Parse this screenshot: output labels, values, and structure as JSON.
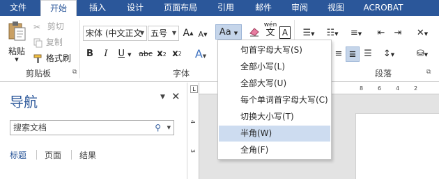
{
  "tabs": [
    {
      "label": "文件"
    },
    {
      "label": "开始"
    },
    {
      "label": "插入"
    },
    {
      "label": "设计"
    },
    {
      "label": "页面布局"
    },
    {
      "label": "引用"
    },
    {
      "label": "邮件"
    },
    {
      "label": "审阅"
    },
    {
      "label": "视图"
    },
    {
      "label": "ACROBAT"
    }
  ],
  "clipboard": {
    "paste_label": "粘贴",
    "cut_label": "剪切",
    "copy_label": "复制",
    "format_painter_label": "格式刷",
    "group_label": "剪贴板"
  },
  "font": {
    "name_value": "宋体 (中文正文",
    "size_value": "五号",
    "grow_label": "A",
    "shrink_label": "A",
    "case_label": "Aa",
    "phonetic_label": "wén",
    "bold_label": "B",
    "italic_label": "I",
    "underline_label": "U",
    "strike_label": "abc",
    "subscript_label": "x",
    "superscript_label": "x",
    "group_label": "字体"
  },
  "paragraph": {
    "group_label": "段落"
  },
  "case_menu": {
    "items": [
      {
        "label": "句首字母大写(S)"
      },
      {
        "label": "全部小写(L)"
      },
      {
        "label": "全部大写(U)"
      },
      {
        "label": "每个单词首字母大写(C)"
      },
      {
        "label": "切换大小写(T)"
      },
      {
        "label": "半角(W)"
      },
      {
        "label": "全角(F)"
      }
    ],
    "hovered_index": 5
  },
  "nav_pane": {
    "title": "导航",
    "search_placeholder": "搜索文档",
    "tabs": [
      {
        "label": "标题"
      },
      {
        "label": "页面"
      },
      {
        "label": "结果"
      }
    ]
  },
  "ruler": {
    "h_numbers": [
      "8",
      "6",
      "4",
      "2"
    ],
    "v_numbers": [
      "4",
      "3"
    ]
  },
  "colors": {
    "accent": "#2b579a",
    "menu_hover": "#cddcf0"
  }
}
